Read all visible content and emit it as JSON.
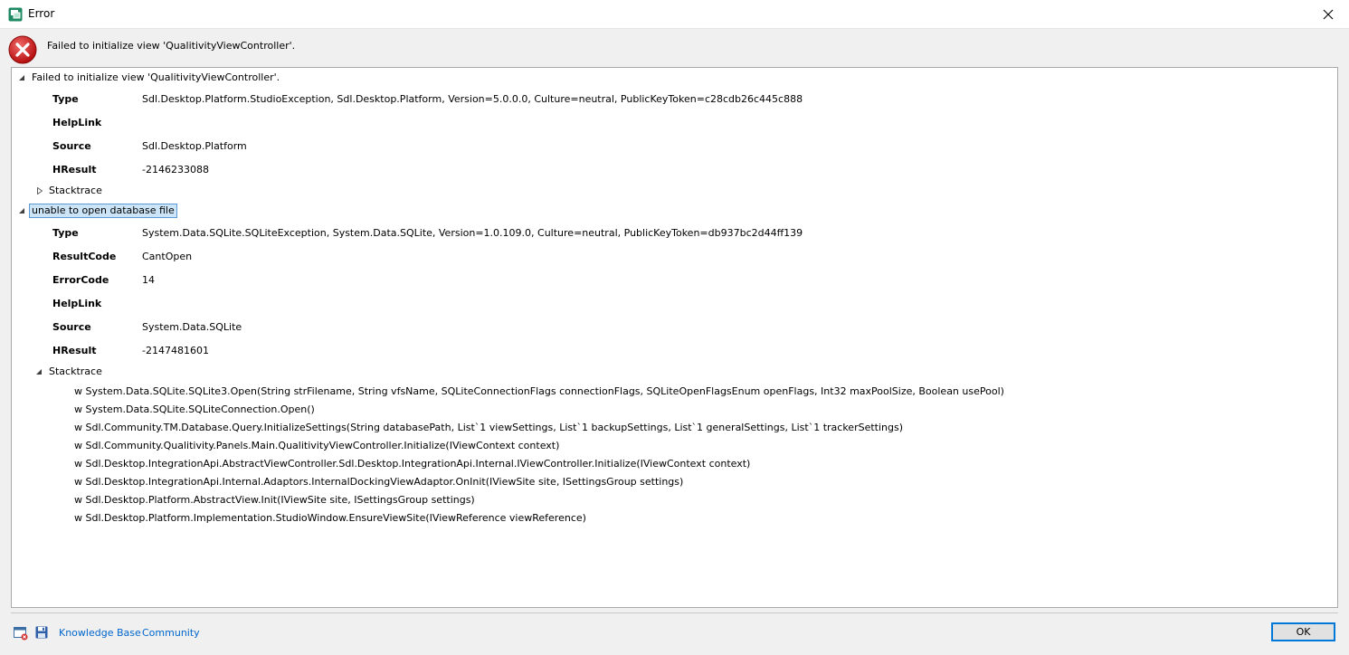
{
  "window": {
    "title": "Error",
    "close_glyph": "✕",
    "icon": "app-window-icon"
  },
  "header": {
    "message": "Failed to initialize view 'QualitivityViewController'.",
    "icon": "error-icon"
  },
  "tree": {
    "node1": {
      "label": "Failed to initialize view 'QualitivityViewController'.",
      "props": [
        {
          "name": "Type",
          "value": "Sdl.Desktop.Platform.StudioException, Sdl.Desktop.Platform, Version=5.0.0.0, Culture=neutral, PublicKeyToken=c28cdb26c445c888"
        },
        {
          "name": "HelpLink",
          "value": ""
        },
        {
          "name": "Source",
          "value": "Sdl.Desktop.Platform"
        },
        {
          "name": "HResult",
          "value": "-2146233088"
        }
      ],
      "stacktrace_label": "Stacktrace"
    },
    "node2": {
      "label": "unable to open database file",
      "props": [
        {
          "name": "Type",
          "value": "System.Data.SQLite.SQLiteException, System.Data.SQLite, Version=1.0.109.0, Culture=neutral, PublicKeyToken=db937bc2d44ff139"
        },
        {
          "name": "ResultCode",
          "value": "CantOpen"
        },
        {
          "name": "ErrorCode",
          "value": "14"
        },
        {
          "name": "HelpLink",
          "value": ""
        },
        {
          "name": "Source",
          "value": "System.Data.SQLite"
        },
        {
          "name": "HResult",
          "value": "-2147481601"
        }
      ],
      "stacktrace_label": "Stacktrace",
      "stacktrace": [
        "w System.Data.SQLite.SQLite3.Open(String strFilename, String vfsName, SQLiteConnectionFlags connectionFlags, SQLiteOpenFlagsEnum openFlags, Int32 maxPoolSize, Boolean usePool)",
        "w System.Data.SQLite.SQLiteConnection.Open()",
        "w Sdl.Community.TM.Database.Query.InitializeSettings(String databasePath, List`1 viewSettings, List`1 backupSettings, List`1 generalSettings, List`1 trackerSettings)",
        "w Sdl.Community.Qualitivity.Panels.Main.QualitivityViewController.Initialize(IViewContext context)",
        "w Sdl.Desktop.IntegrationApi.AbstractViewController.Sdl.Desktop.IntegrationApi.Internal.IViewController.Initialize(IViewContext context)",
        "w Sdl.Desktop.IntegrationApi.Internal.Adaptors.InternalDockingViewAdaptor.OnInit(IViewSite site, ISettingsGroup settings)",
        "w Sdl.Desktop.Platform.AbstractView.Init(IViewSite site, ISettingsGroup settings)",
        "w Sdl.Desktop.Platform.Implementation.StudioWindow.EnsureViewSite(IViewReference viewReference)"
      ]
    }
  },
  "footer": {
    "knowledge_base": "Knowledge Base",
    "community": "Community",
    "ok": "OK"
  }
}
